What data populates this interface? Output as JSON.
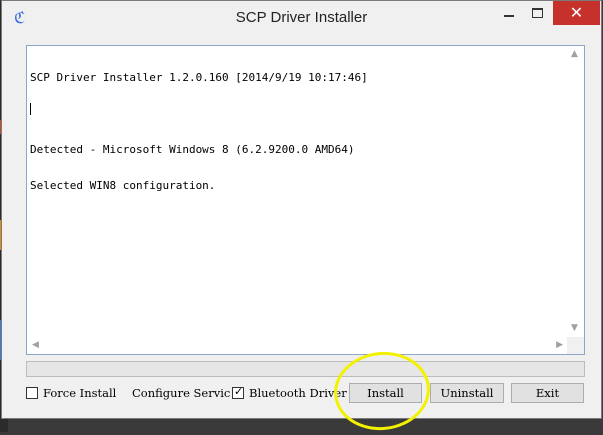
{
  "window": {
    "title": "SCP Driver Installer",
    "app_icon": "scp-logo-icon",
    "caption": {
      "minimize_icon": "minimize-icon",
      "maximize_icon": "maximize-icon",
      "close_glyph": "✕"
    }
  },
  "log": {
    "lines": [
      "SCP Driver Installer 1.2.0.160 [2014/9/19 10:17:46]",
      "",
      "Detected - Microsoft Windows 8 (6.2.9200.0 AMD64)",
      "Selected WIN8 configuration."
    ]
  },
  "progress": {
    "value": 0
  },
  "options": {
    "force_install": {
      "label": "Force Install",
      "checked": false
    },
    "configure_service": {
      "label": "Configure Servic",
      "checked": true
    },
    "bluetooth_driver": {
      "label": "Bluetooth Driver",
      "checked": true
    }
  },
  "buttons": {
    "install": "Install",
    "uninstall": "Uninstall",
    "exit": "Exit"
  },
  "colors": {
    "close": "#c7312b",
    "annotation": "#f2f200"
  }
}
